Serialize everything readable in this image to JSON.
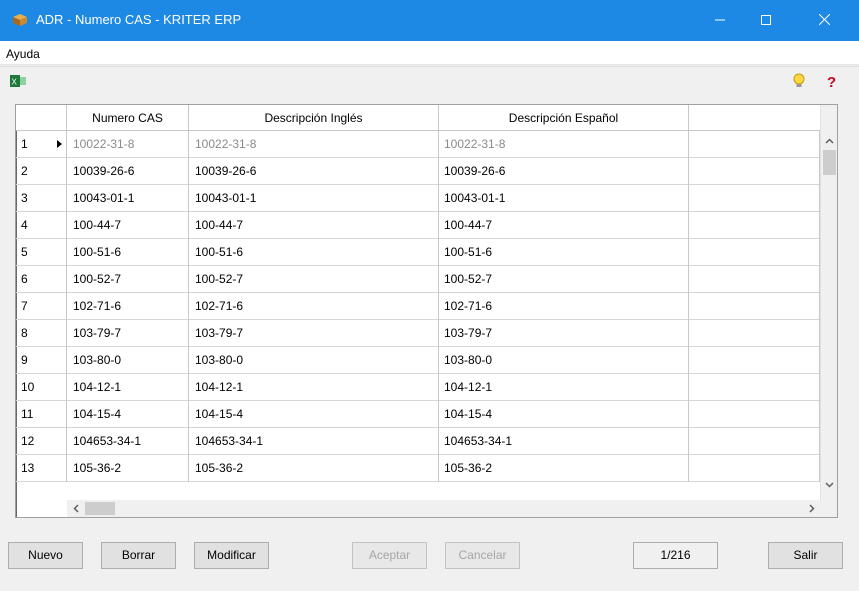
{
  "window": {
    "title": "ADR - Numero CAS - KRITER ERP",
    "icon": "package-icon",
    "controls": [
      "minimize-icon",
      "maximize-icon",
      "close-icon"
    ]
  },
  "menu": {
    "items": [
      "Ayuda"
    ]
  },
  "toolbar": {
    "icons": [
      "excel-export-icon",
      "lightbulb-icon",
      "help-icon"
    ]
  },
  "grid": {
    "columns": [
      "",
      "Numero CAS",
      "Descripción Inglés",
      "Descripción Español",
      ""
    ],
    "rows": [
      {
        "n": "1",
        "cas": "10022-31-8",
        "ing": "10022-31-8",
        "esp": "10022-31-8"
      },
      {
        "n": "2",
        "cas": "10039-26-6",
        "ing": "10039-26-6",
        "esp": "10039-26-6"
      },
      {
        "n": "3",
        "cas": "10043-01-1",
        "ing": "10043-01-1",
        "esp": "10043-01-1"
      },
      {
        "n": "4",
        "cas": "100-44-7",
        "ing": "100-44-7",
        "esp": "100-44-7"
      },
      {
        "n": "5",
        "cas": "100-51-6",
        "ing": "100-51-6",
        "esp": "100-51-6"
      },
      {
        "n": "6",
        "cas": "100-52-7",
        "ing": "100-52-7",
        "esp": "100-52-7"
      },
      {
        "n": "7",
        "cas": "102-71-6",
        "ing": "102-71-6",
        "esp": "102-71-6"
      },
      {
        "n": "8",
        "cas": "103-79-7",
        "ing": "103-79-7",
        "esp": "103-79-7"
      },
      {
        "n": "9",
        "cas": "103-80-0",
        "ing": "103-80-0",
        "esp": "103-80-0"
      },
      {
        "n": "10",
        "cas": "104-12-1",
        "ing": "104-12-1",
        "esp": "104-12-1"
      },
      {
        "n": "11",
        "cas": "104-15-4",
        "ing": "104-15-4",
        "esp": "104-15-4"
      },
      {
        "n": "12",
        "cas": "104653-34-1",
        "ing": "104653-34-1",
        "esp": "104653-34-1"
      },
      {
        "n": "13",
        "cas": "105-36-2",
        "ing": "105-36-2",
        "esp": "105-36-2"
      }
    ]
  },
  "buttons": {
    "nuevo": "Nuevo",
    "borrar": "Borrar",
    "modificar": "Modificar",
    "aceptar": "Aceptar",
    "cancelar": "Cancelar",
    "salir": "Salir"
  },
  "record_counter": "1/216",
  "colors": {
    "titlebar": "#1e88e5",
    "disabled_text": "#a6a6a6"
  }
}
